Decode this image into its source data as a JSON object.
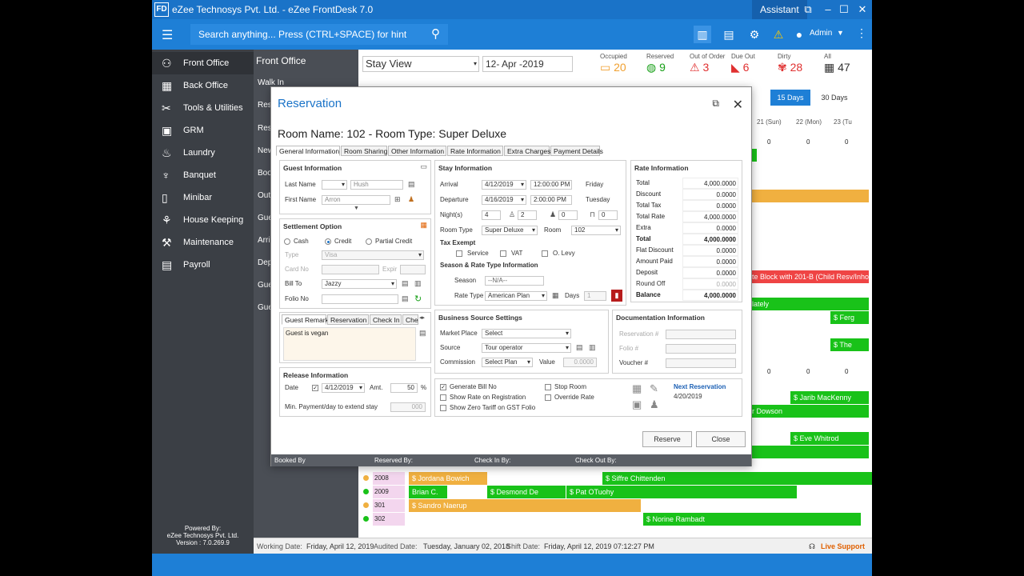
{
  "app": {
    "logo": "FD",
    "title": "eZee Technosys Pvt. Ltd. - eZee FrontDesk 7.0",
    "assistant": "Assistant",
    "search_placeholder": "Search anything... Press (CTRL+SPACE) for hint",
    "user": "Admin"
  },
  "sidebar": {
    "items": [
      {
        "label": "Front Office",
        "icon": "front-office-icon"
      },
      {
        "label": "Back Office",
        "icon": "back-office-icon"
      },
      {
        "label": "Tools & Utilities",
        "icon": "tools-icon"
      },
      {
        "label": "GRM",
        "icon": "grm-icon"
      },
      {
        "label": "Laundry",
        "icon": "laundry-icon"
      },
      {
        "label": "Banquet",
        "icon": "banquet-icon"
      },
      {
        "label": "Minibar",
        "icon": "minibar-icon"
      },
      {
        "label": "House Keeping",
        "icon": "housekeeping-icon"
      },
      {
        "label": "Maintenance",
        "icon": "maintenance-icon"
      },
      {
        "label": "Payroll",
        "icon": "payroll-icon"
      }
    ],
    "powered": "Powered By:",
    "company": "eZee Technosys Pvt. Ltd.",
    "version": "Version : 7.0.269.9"
  },
  "subnav": {
    "header": "Front Office",
    "items": [
      "Walk In",
      "Rese",
      "Rese",
      "New",
      "Boo",
      "Out",
      "Gue",
      "Arri",
      "Dep",
      "Gue",
      "Gue"
    ]
  },
  "view": {
    "select": "Stay View",
    "date": "12- Apr -2019"
  },
  "stats": [
    {
      "label": "Occupied",
      "value": "20",
      "color": "#f0a030"
    },
    {
      "label": "Reserved",
      "value": "9",
      "color": "#19a019"
    },
    {
      "label": "Out of Order",
      "value": "3",
      "color": "#e03030"
    },
    {
      "label": "Due Out",
      "value": "6",
      "color": "#e03030"
    },
    {
      "label": "Dirty",
      "value": "28",
      "color": "#e03030"
    },
    {
      "label": "All",
      "value": "47",
      "color": "#333333"
    }
  ],
  "range_buttons": [
    "15 Days",
    "30 Days"
  ],
  "calendar": {
    "days": [
      "21 (Sun)",
      "22 (Mon)",
      "23 (Tu"
    ],
    "zero": "0",
    "rooms": [
      "2008",
      "2009",
      "301",
      "302"
    ],
    "bars": [
      "Ferg",
      "The",
      "te Block with 201-B (Child Resv/Inho",
      "lately",
      "Jarib MacKenny",
      "r Dowson",
      "Eve Whitrod",
      "Jordana Bowich",
      "Siffre Chittenden",
      "Brian C.",
      "Desmond De",
      "Pat OTuohy",
      "Sandro Naerup",
      "Norine Rambadt"
    ]
  },
  "status": {
    "working_label": "Working Date:",
    "working": "Friday, April 12, 2019",
    "audited_label": "Audited Date:",
    "audited": "Tuesday, January 02, 2018",
    "shift_label": "Shift Date:",
    "shift": "Friday, April 12, 2019 07:12:27 PM",
    "live_support": "Live Support"
  },
  "dialog": {
    "title": "Reservation",
    "room_name": "Room Name: 102 - Room Type: Super Deluxe",
    "tabs": [
      "General Information",
      "Room Sharing",
      "Other Information",
      "Rate Information",
      "Extra Charges",
      "Payment Details"
    ],
    "guest": {
      "header": "Guest Information",
      "last_name_label": "Last Name",
      "last_name": "Hush",
      "first_name_label": "First Name",
      "first_name": "Arron"
    },
    "settlement": {
      "header": "Settlement Option",
      "cash": "Cash",
      "credit": "Credit",
      "partial": "Partial Credit",
      "type_label": "Type",
      "type": "Visa",
      "card_label": "Card No",
      "expiry_label": "Expir",
      "bill_to_label": "Bill To",
      "bill_to": "Jazzy",
      "folio_label": "Folio No"
    },
    "remark_tabs": [
      "Guest Remark",
      "Reservation",
      "Check In",
      "Che"
    ],
    "remark": "Guest is vegan",
    "release": {
      "header": "Release Information",
      "date_label": "Date",
      "date": "4/12/2019",
      "amt_label": "Amt.",
      "amt": "50",
      "pct": "%",
      "min_label": "Min. Payment/day to extend stay",
      "min": "000"
    },
    "stay": {
      "header": "Stay Information",
      "arrival_label": "Arrival",
      "arrival": "4/12/2019",
      "arrival_time": "12:00:00 PM",
      "arrival_day": "Friday",
      "departure_label": "Departure",
      "departure": "4/16/2019",
      "departure_time": "2:00:00 PM",
      "departure_day": "Tuesday",
      "nights_label": "Night(s)",
      "nights": "4",
      "adults": "2",
      "children": "0",
      "extra": "0",
      "room_type_label": "Room Type",
      "room_type": "Super Deluxe",
      "room_label": "Room",
      "room": "102",
      "tax_label": "Tax Exempt",
      "service": "Service",
      "vat": "VAT",
      "olevy": "O. Levy",
      "season_header": "Season & Rate Type Information",
      "season_label": "Season",
      "season": "--N/A--",
      "rate_type_label": "Rate Type",
      "rate_type": "American Plan",
      "days_label": "Days",
      "days": "1"
    },
    "rate": {
      "header": "Rate Information",
      "rows": [
        {
          "label": "Total",
          "value": "4,000.0000",
          "bold": false
        },
        {
          "label": "Discount",
          "value": "0.0000",
          "bold": false
        },
        {
          "label": "Total Tax",
          "value": "0.0000",
          "bold": false
        },
        {
          "label": "Total Rate",
          "value": "4,000.0000",
          "bold": false
        },
        {
          "label": "Extra",
          "value": "0.0000",
          "bold": false
        },
        {
          "label": "Total",
          "value": "4,000.0000",
          "bold": true
        },
        {
          "label": "Flat Discount",
          "value": "0.0000",
          "bold": false
        },
        {
          "label": "Amount Paid",
          "value": "0.0000",
          "bold": false
        },
        {
          "label": "Deposit",
          "value": "0.0000",
          "bold": false
        },
        {
          "label": "Round Off",
          "value": "0.0000",
          "bold": false
        },
        {
          "label": "Balance",
          "value": "4,000.0000",
          "bold": true
        }
      ]
    },
    "business": {
      "header": "Business Source Settings",
      "market_label": "Market Place",
      "market": "Select",
      "source_label": "Source",
      "source": "Tour operator",
      "commission_label": "Commission",
      "commission": "Select Plan",
      "value_label": "Value",
      "value": "0.0000"
    },
    "documentation": {
      "header": "Documentation Information",
      "reservation_label": "Reservation #",
      "folio_label": "Folio #",
      "voucher_label": "Voucher #"
    },
    "options": {
      "generate_bill": "Generate Bill No",
      "show_rate": "Show Rate on Registration",
      "show_zero": "Show Zero Tariff on GST Folio",
      "stop_room": "Stop Room",
      "override_rate": "Override Rate"
    },
    "next": {
      "label": "Next Reservation",
      "date": "4/20/2019"
    },
    "buttons": {
      "reserve": "Reserve",
      "close": "Close"
    },
    "footer": {
      "booked_by": "Booked By",
      "reserved_by": "Reserved By:",
      "checkin_by": "Check In By:",
      "checkout_by": "Check Out By:"
    }
  }
}
